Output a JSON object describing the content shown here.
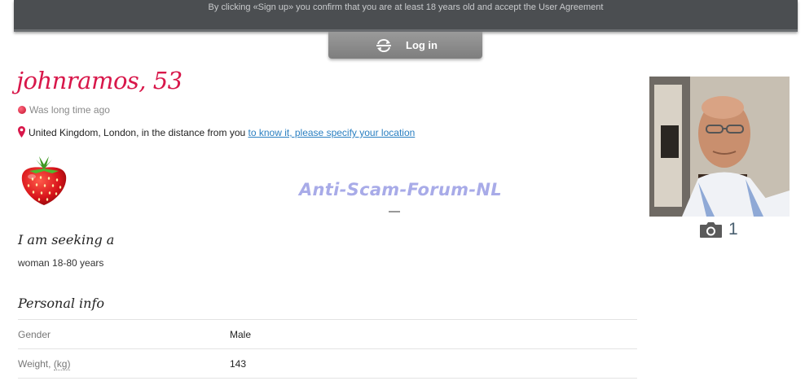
{
  "topbar": {
    "notice": "By clicking «Sign up» you confirm that you are at least 18 years old and accept the User Agreement"
  },
  "login": {
    "label": "Log in",
    "icon": "refresh-arrows-icon"
  },
  "profile": {
    "name_age": "johnramos, 53",
    "status": "Was long time ago",
    "location_text": "United Kingdom, London, in the distance from you",
    "location_link": "to know it, please specify your location",
    "badge_icon": "strawberry-icon",
    "photo_icon": "camera-icon",
    "photo_count": "1"
  },
  "watermark": "Anti-Scam-Forum-NL",
  "seeking": {
    "heading": "I am seeking a",
    "value": "woman 18-80 years"
  },
  "personal_info": {
    "heading": "Personal info",
    "rows": [
      {
        "key": "Gender",
        "value": "Male"
      },
      {
        "key": "Weight,",
        "unit": "(kg)",
        "value": "143"
      }
    ]
  },
  "colors": {
    "name": "#d8174a",
    "link": "#2a7fc1",
    "topbar": "#4b4e51",
    "button": "#8c8c8c"
  }
}
